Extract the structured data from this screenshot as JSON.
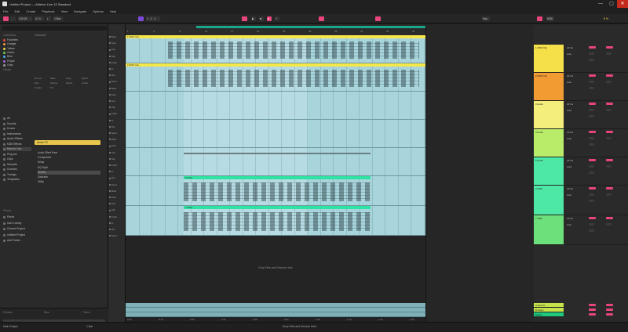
{
  "window": {
    "title": "Untitled Project — Ableton Live 12 Standard",
    "controls": [
      "—",
      "▢",
      "✕"
    ]
  },
  "menu": [
    "File",
    "Edit",
    "Create",
    "Playback",
    "View",
    "Navigate",
    "Options",
    "Help"
  ],
  "controlbar": {
    "tempo": "120.00",
    "signature": "4 / 4",
    "bar": "1 Bar",
    "position": "1 . 1 . 1",
    "key": "Key",
    "midi": "MIDI",
    "cpu": "8 %"
  },
  "browser": {
    "collections_label": "Collections",
    "collections": [
      {
        "label": "Favorites",
        "color": "#e34b4b"
      },
      {
        "label": "Orange",
        "color": "#f19b3b"
      },
      {
        "label": "Yellow",
        "color": "#e8d24b"
      },
      {
        "label": "Green",
        "color": "#6ccf55"
      },
      {
        "label": "Blue",
        "color": "#49a8e8"
      },
      {
        "label": "Purple",
        "color": "#9b62dc"
      },
      {
        "label": "Gray",
        "color": "#9a9a9a"
      }
    ],
    "library_label": "Library",
    "library": [
      "All",
      "Sounds",
      "Drums",
      "Instruments",
      "Audio Effects",
      "MIDI Effects",
      "Max for Live",
      "Plug-Ins",
      "Clips",
      "Samples",
      "Grooves",
      "Tunings",
      "Templates"
    ],
    "places_label": "Places",
    "places": [
      "Packs",
      "User Library",
      "Current Project",
      "Untitled Project",
      "Add Folder…"
    ],
    "col2_title": "Character",
    "col2_groups": [
      "Drums",
      "Bass",
      "Keys",
      "Synth",
      "Pad",
      "Strings",
      "Winds",
      "Guitar",
      "Vocals",
      "FX"
    ],
    "highlight": "Audio FX",
    "files": [
      "Audio Effect Rack",
      "Compressor",
      "Delay",
      "EQ Eight",
      "Reverb",
      "Saturator",
      "Utility"
    ],
    "footer_label": "Preview",
    "footer_hint": "Raw",
    "footer_count": "7 Items"
  },
  "arrangement": {
    "ruler_ticks": [
      "1",
      "5",
      "9",
      "13",
      "17",
      "21",
      "25",
      "29",
      "33",
      "37",
      "41",
      "45"
    ],
    "tracks": [
      {
        "name": "1 MIDI Clip",
        "clip": "1 MIDI Clip",
        "color": "#f5e64a"
      },
      {
        "name": "2 MIDI Clip",
        "clip": "2 MIDI Clip",
        "color": "#f5e64a"
      },
      {
        "name": "3 Audio",
        "clip": "",
        "color": ""
      },
      {
        "name": "4 Audio",
        "clip": "",
        "color": ""
      },
      {
        "name": "5 Audio",
        "clip": "",
        "color": ""
      },
      {
        "name": "6 MIDI",
        "clip": "6 MIDI",
        "color": "#2fe3a2"
      },
      {
        "name": "7 MIDI",
        "clip": "7 MIDI",
        "color": "#2fe3a2"
      }
    ],
    "empty_msg": "Drop Files and Devices Here",
    "time_ticks": [
      "0:00",
      "0:10",
      "0:20",
      "0:30",
      "0:40",
      "0:50",
      "1:00",
      "1:10",
      "1:20",
      "1:30"
    ]
  },
  "track_strip": [
    "Mute",
    "Solo",
    "Arm",
    "Clip",
    "Track",
    "In",
    "Out",
    "Send",
    "Mute",
    "Solo",
    "Arm",
    "Clip",
    "Track",
    "In",
    "Out",
    "Send",
    "Mute",
    "Solo",
    "Arm",
    "Clip",
    "Track",
    "In",
    "Out",
    "Send",
    "Mute",
    "Solo",
    "Arm",
    "Clip",
    "Track",
    "In",
    "Out",
    "Send"
  ],
  "mixer": {
    "slots": [
      {
        "name": "1 MIDI Clip",
        "color": "#f5e04a"
      },
      {
        "name": "2 MIDI Clip",
        "color": "#f29b32"
      },
      {
        "name": "3 Audio",
        "color": "#f4ee7a"
      },
      {
        "name": "4 Audio",
        "color": "#b8ec69"
      },
      {
        "name": "5 Audio",
        "color": "#4ee8a6"
      },
      {
        "name": "6 MIDI",
        "color": "#4ee8a6"
      },
      {
        "name": "7 MIDI",
        "color": "#6ce07a"
      }
    ],
    "strip_label": "All Ins",
    "monitor": "Auto",
    "returns": [
      {
        "name": "A Reverb",
        "color": "#c3e34a"
      },
      {
        "name": "B Delay",
        "color": "#c3e34a"
      },
      {
        "name": "Master",
        "color": "#1fc97c"
      }
    ]
  },
  "status": {
    "left": "Main Output",
    "mid": "1-Bar",
    "right": "Drop Files and Devices Here"
  }
}
